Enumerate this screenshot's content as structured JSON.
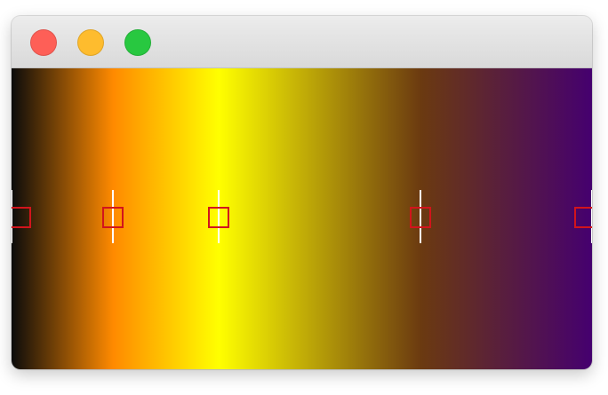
{
  "window": {
    "traffic_lights": {
      "close_color": "#fe5f57",
      "minimize_color": "#febc2e",
      "zoom_color": "#28c840"
    }
  },
  "gradient": {
    "type": "linear",
    "direction": "to right",
    "stops": [
      {
        "color": "#0b0b0b",
        "position": 0
      },
      {
        "color": "#ff8a00",
        "position": 0.175
      },
      {
        "color": "#ffff00",
        "position": 0.357
      },
      {
        "color": "#6b3a10",
        "position": 0.705
      },
      {
        "color": "#45006f",
        "position": 1.0
      }
    ],
    "marker_color": "#d2141c"
  }
}
